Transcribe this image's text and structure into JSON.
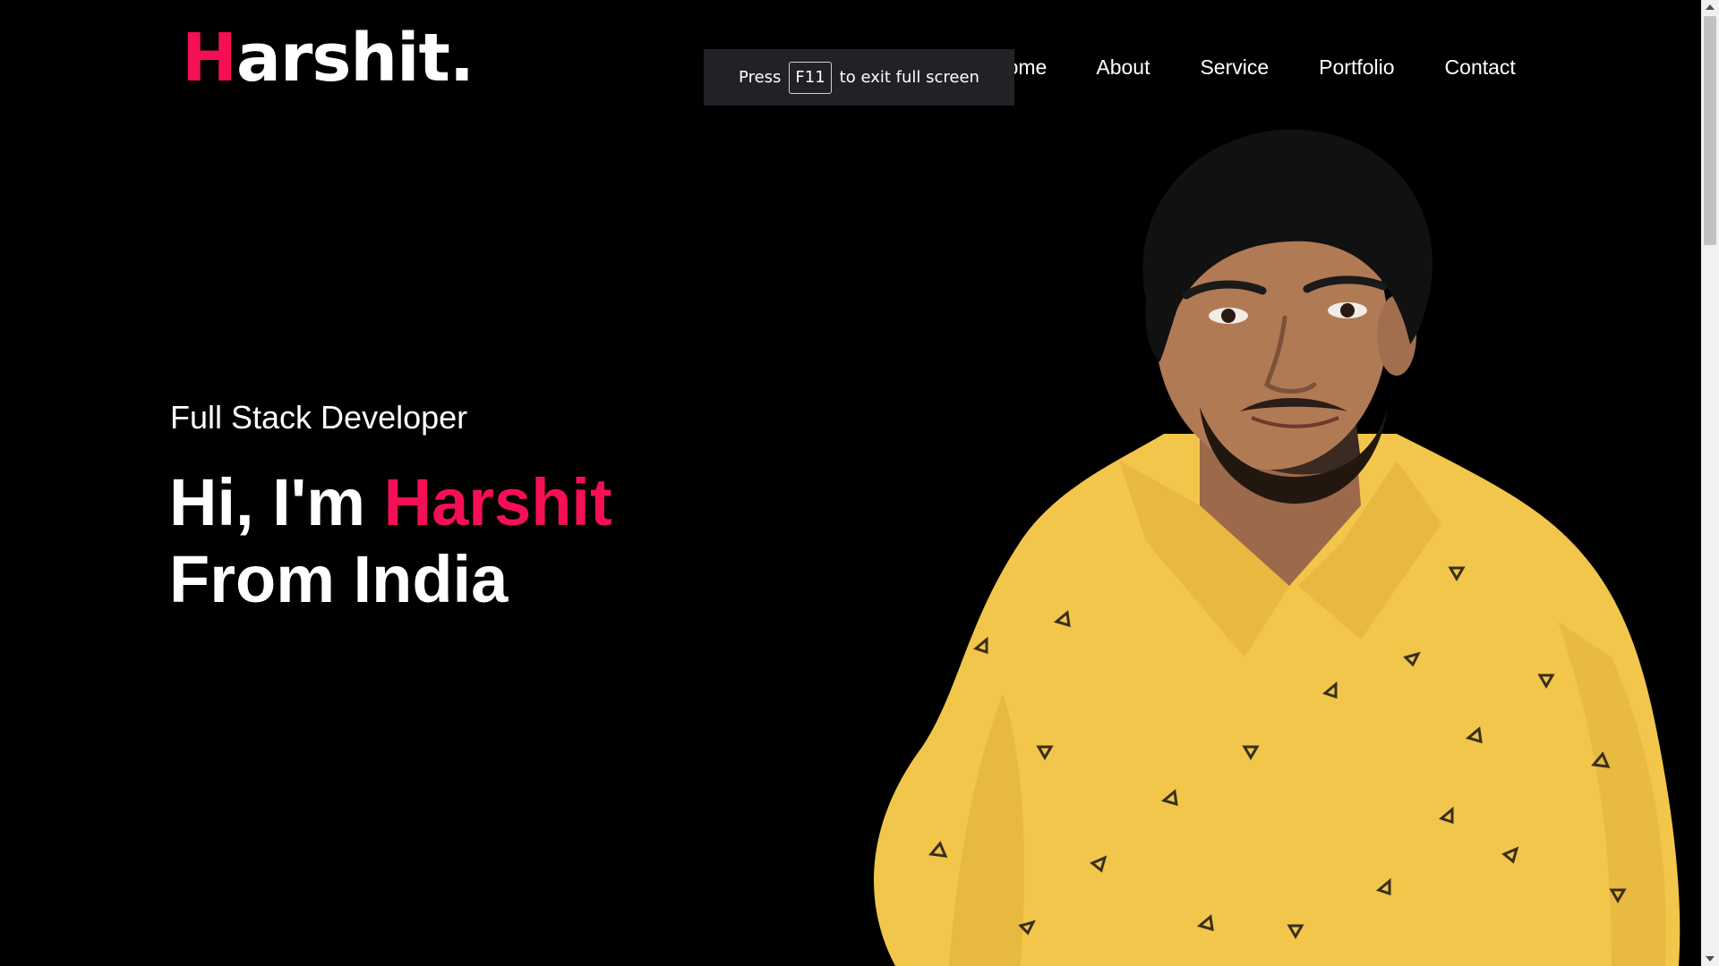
{
  "logo": {
    "main": "arshit.",
    "first_letter": "H"
  },
  "nav": {
    "items": [
      "Home",
      "About",
      "Service",
      "Portfolio",
      "Contact"
    ]
  },
  "fullscreen_toast": {
    "prefix": "Press",
    "key": "F11",
    "suffix": "to exit full screen"
  },
  "hero": {
    "subtitle": "Full Stack Developer",
    "greeting": "Hi, I'm",
    "name": "Harshit",
    "line2": "From India"
  },
  "colors": {
    "accent": "#f50f54",
    "background": "#000000",
    "text": "#ffffff",
    "shirt": "#f2c64a"
  },
  "icons": [
    "scroll-up-arrow-icon",
    "scroll-down-arrow-icon"
  ]
}
